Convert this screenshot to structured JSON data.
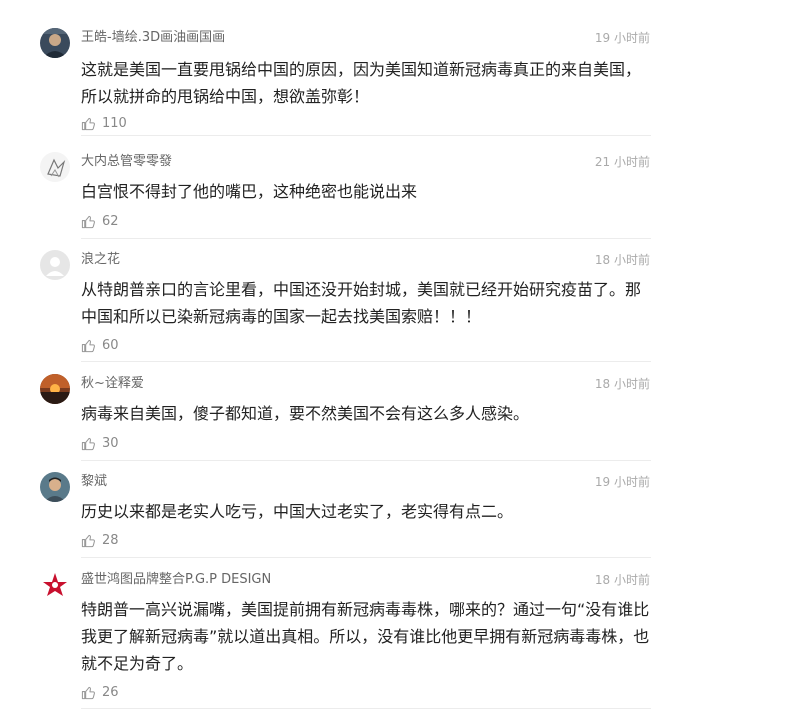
{
  "comments": [
    {
      "user": "王皓-墙绘.3D画油画国画",
      "time": "19 小时前",
      "text": "这就是美国一直要甩锅给中国的原因，因为美国知道新冠病毒真正的来自美国，所以就拼命的甩锅给中国，想欲盖弥彰！",
      "likes": "110",
      "avatar_icon": "avatar-photo-man-icon",
      "avatar_color": "#3a4a5c"
    },
    {
      "user": "大内总管零零發",
      "time": "21 小时前",
      "text": "白宫恨不得封了他的嘴巴，这种绝密也能说出来",
      "likes": "62",
      "avatar_icon": "avatar-bird-sketch-icon",
      "avatar_color": "#f4f4f4"
    },
    {
      "user": "浪之花",
      "time": "18 小时前",
      "text": "从特朗普亲口的言论里看，中国还没开始封城，美国就已经开始研究疫苗了。那中国和所以已染新冠病毒的国家一起去找美国索赔！！！",
      "likes": "60",
      "avatar_icon": "avatar-default-icon",
      "avatar_color": "#e6e6e6"
    },
    {
      "user": "秋~诠释爱",
      "time": "18 小时前",
      "text": "病毒来自美国，傻子都知道，要不然美国不会有这么多人感染。",
      "likes": "30",
      "avatar_icon": "avatar-sunset-icon",
      "avatar_color": "#7a3b1e"
    },
    {
      "user": "黎斌",
      "time": "19 小时前",
      "text": "历史以来都是老实人吃亏，中国大过老实了，老实得有点二。",
      "likes": "28",
      "avatar_icon": "avatar-photo-man-icon",
      "avatar_color": "#5a7a8a"
    },
    {
      "user": "盛世鸿图品牌整合P.G.P DESIGN",
      "time": "18 小时前",
      "text": "特朗普一高兴说漏嘴，美国提前拥有新冠病毒毒株，哪来的？通过一句“没有谁比我更了解新冠病毒”就以道出真相。所以，没有谁比他更早拥有新冠病毒毒株，也就不足为奇了。",
      "likes": "26",
      "avatar_icon": "avatar-red-star-logo-icon",
      "avatar_color": "#c8102e"
    }
  ],
  "colors": {
    "username": "#666666",
    "time": "#aaaaaa",
    "text": "#222222",
    "likes": "#888888",
    "divider": "#ececec"
  }
}
